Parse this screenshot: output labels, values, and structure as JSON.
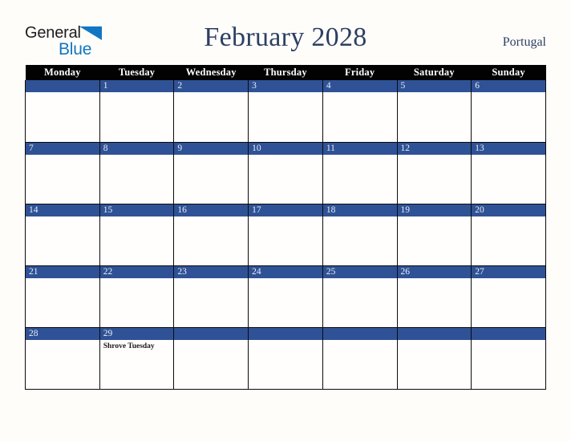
{
  "brand": {
    "name_part1": "General",
    "name_part2": "Blue",
    "triangle_color": "#1276c3",
    "text_color": "#1d1d1d"
  },
  "header": {
    "title": "February 2028",
    "country": "Portugal",
    "title_color": "#2c3f63"
  },
  "calendar": {
    "accent_color": "#2f5296",
    "header_bg": "#020203",
    "weekdays": [
      "Monday",
      "Tuesday",
      "Wednesday",
      "Thursday",
      "Friday",
      "Saturday",
      "Sunday"
    ],
    "weeks": [
      [
        {
          "day": "",
          "event": ""
        },
        {
          "day": "1",
          "event": ""
        },
        {
          "day": "2",
          "event": ""
        },
        {
          "day": "3",
          "event": ""
        },
        {
          "day": "4",
          "event": ""
        },
        {
          "day": "5",
          "event": ""
        },
        {
          "day": "6",
          "event": ""
        }
      ],
      [
        {
          "day": "7",
          "event": ""
        },
        {
          "day": "8",
          "event": ""
        },
        {
          "day": "9",
          "event": ""
        },
        {
          "day": "10",
          "event": ""
        },
        {
          "day": "11",
          "event": ""
        },
        {
          "day": "12",
          "event": ""
        },
        {
          "day": "13",
          "event": ""
        }
      ],
      [
        {
          "day": "14",
          "event": ""
        },
        {
          "day": "15",
          "event": ""
        },
        {
          "day": "16",
          "event": ""
        },
        {
          "day": "17",
          "event": ""
        },
        {
          "day": "18",
          "event": ""
        },
        {
          "day": "19",
          "event": ""
        },
        {
          "day": "20",
          "event": ""
        }
      ],
      [
        {
          "day": "21",
          "event": ""
        },
        {
          "day": "22",
          "event": ""
        },
        {
          "day": "23",
          "event": ""
        },
        {
          "day": "24",
          "event": ""
        },
        {
          "day": "25",
          "event": ""
        },
        {
          "day": "26",
          "event": ""
        },
        {
          "day": "27",
          "event": ""
        }
      ],
      [
        {
          "day": "28",
          "event": ""
        },
        {
          "day": "29",
          "event": "Shrove Tuesday"
        },
        {
          "day": "",
          "event": ""
        },
        {
          "day": "",
          "event": ""
        },
        {
          "day": "",
          "event": ""
        },
        {
          "day": "",
          "event": ""
        },
        {
          "day": "",
          "event": ""
        }
      ]
    ]
  }
}
